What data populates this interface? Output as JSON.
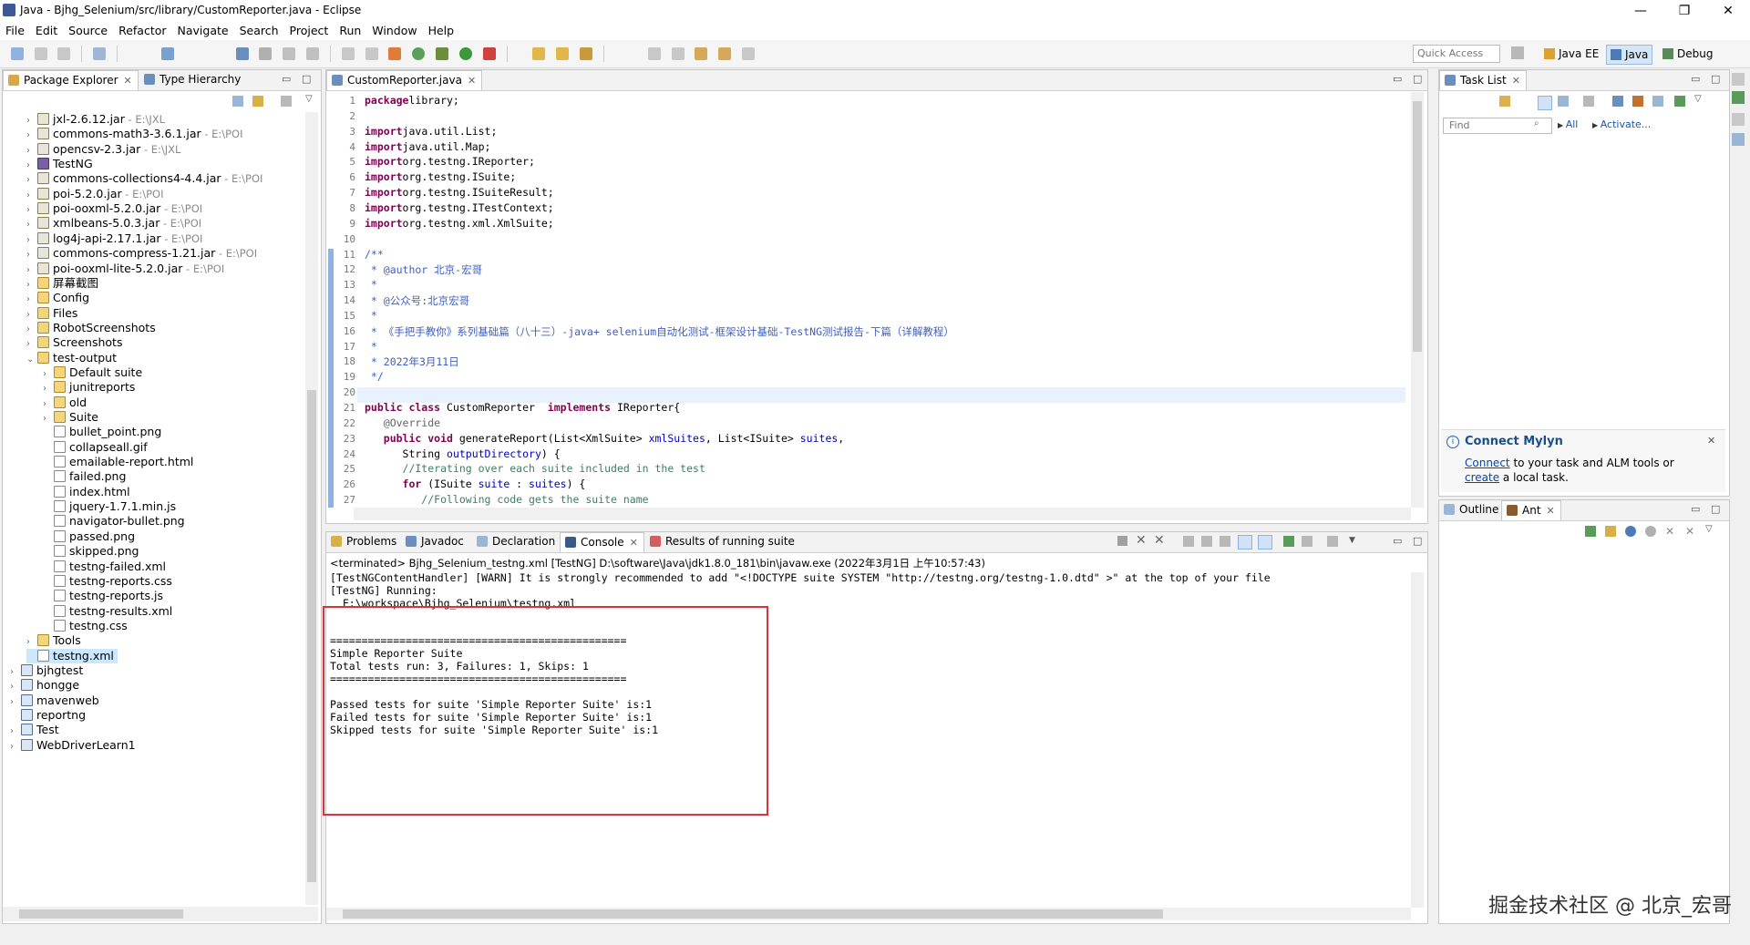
{
  "window": {
    "title": "Java - Bjhg_Selenium/src/library/CustomReporter.java - Eclipse",
    "controls": [
      "—",
      "❐",
      "✕"
    ]
  },
  "menu": [
    "File",
    "Edit",
    "Source",
    "Refactor",
    "Navigate",
    "Search",
    "Project",
    "Run",
    "Window",
    "Help"
  ],
  "toolbar": {
    "quick_access_placeholder": "Quick Access",
    "perspectives": [
      "Java EE",
      "Java",
      "Debug"
    ]
  },
  "package_explorer": {
    "tab1": "Package Explorer",
    "tab2": "Type Hierarchy",
    "items": [
      {
        "label": "jxl-2.6.12.jar",
        "loc": " - E:\\JXL",
        "type": "jar",
        "depth": 1,
        "arrow": "›"
      },
      {
        "label": "commons-math3-3.6.1.jar",
        "loc": " - E:\\POI",
        "type": "jar",
        "depth": 1,
        "arrow": "›"
      },
      {
        "label": "opencsv-2.3.jar",
        "loc": " - E:\\JXL",
        "type": "jar",
        "depth": 1,
        "arrow": "›"
      },
      {
        "label": "TestNG",
        "loc": "",
        "type": "lib",
        "depth": 1,
        "arrow": "›"
      },
      {
        "label": "commons-collections4-4.4.jar",
        "loc": " - E:\\POI",
        "type": "jar",
        "depth": 1,
        "arrow": "›"
      },
      {
        "label": "poi-5.2.0.jar",
        "loc": " - E:\\POI",
        "type": "jar",
        "depth": 1,
        "arrow": "›"
      },
      {
        "label": "poi-ooxml-5.2.0.jar",
        "loc": " - E:\\POI",
        "type": "jar",
        "depth": 1,
        "arrow": "›"
      },
      {
        "label": "xmlbeans-5.0.3.jar",
        "loc": " - E:\\POI",
        "type": "jar",
        "depth": 1,
        "arrow": "›"
      },
      {
        "label": "log4j-api-2.17.1.jar",
        "loc": " - E:\\POI",
        "type": "jar",
        "depth": 1,
        "arrow": "›"
      },
      {
        "label": "commons-compress-1.21.jar",
        "loc": " - E:\\POI",
        "type": "jar",
        "depth": 1,
        "arrow": "›"
      },
      {
        "label": "poi-ooxml-lite-5.2.0.jar",
        "loc": " - E:\\POI",
        "type": "jar",
        "depth": 1,
        "arrow": "›"
      },
      {
        "label": "屏幕截图",
        "loc": "",
        "type": "folder",
        "depth": 1,
        "arrow": "›"
      },
      {
        "label": "Config",
        "loc": "",
        "type": "folder",
        "depth": 1,
        "arrow": "›"
      },
      {
        "label": "Files",
        "loc": "",
        "type": "folder",
        "depth": 1,
        "arrow": "›"
      },
      {
        "label": "RobotScreenshots",
        "loc": "",
        "type": "folder",
        "depth": 1,
        "arrow": "›"
      },
      {
        "label": "Screenshots",
        "loc": "",
        "type": "folder",
        "depth": 1,
        "arrow": "›"
      },
      {
        "label": "test-output",
        "loc": "",
        "type": "folder",
        "depth": 1,
        "arrow": "⌄"
      },
      {
        "label": "Default suite",
        "loc": "",
        "type": "folder",
        "depth": 2,
        "arrow": "›"
      },
      {
        "label": "junitreports",
        "loc": "",
        "type": "folder",
        "depth": 2,
        "arrow": "›"
      },
      {
        "label": "old",
        "loc": "",
        "type": "folder",
        "depth": 2,
        "arrow": "›"
      },
      {
        "label": "Suite",
        "loc": "",
        "type": "folder",
        "depth": 2,
        "arrow": "›"
      },
      {
        "label": "bullet_point.png",
        "loc": "",
        "type": "file",
        "depth": 2,
        "arrow": ""
      },
      {
        "label": "collapseall.gif",
        "loc": "",
        "type": "file",
        "depth": 2,
        "arrow": ""
      },
      {
        "label": "emailable-report.html",
        "loc": "",
        "type": "file",
        "depth": 2,
        "arrow": ""
      },
      {
        "label": "failed.png",
        "loc": "",
        "type": "file",
        "depth": 2,
        "arrow": ""
      },
      {
        "label": "index.html",
        "loc": "",
        "type": "file",
        "depth": 2,
        "arrow": ""
      },
      {
        "label": "jquery-1.7.1.min.js",
        "loc": "",
        "type": "file",
        "depth": 2,
        "arrow": ""
      },
      {
        "label": "navigator-bullet.png",
        "loc": "",
        "type": "file",
        "depth": 2,
        "arrow": ""
      },
      {
        "label": "passed.png",
        "loc": "",
        "type": "file",
        "depth": 2,
        "arrow": ""
      },
      {
        "label": "skipped.png",
        "loc": "",
        "type": "file",
        "depth": 2,
        "arrow": ""
      },
      {
        "label": "testng-failed.xml",
        "loc": "",
        "type": "file",
        "depth": 2,
        "arrow": ""
      },
      {
        "label": "testng-reports.css",
        "loc": "",
        "type": "file",
        "depth": 2,
        "arrow": ""
      },
      {
        "label": "testng-reports.js",
        "loc": "",
        "type": "file",
        "depth": 2,
        "arrow": ""
      },
      {
        "label": "testng-results.xml",
        "loc": "",
        "type": "file",
        "depth": 2,
        "arrow": ""
      },
      {
        "label": "testng.css",
        "loc": "",
        "type": "file",
        "depth": 2,
        "arrow": ""
      },
      {
        "label": "Tools",
        "loc": "",
        "type": "folder",
        "depth": 1,
        "arrow": "›"
      },
      {
        "label": "testng.xml",
        "loc": "",
        "type": "file",
        "depth": 1,
        "arrow": "",
        "selected": true
      },
      {
        "label": "bjhgtest",
        "loc": "",
        "type": "proj",
        "depth": 0,
        "arrow": "›"
      },
      {
        "label": "hongge",
        "loc": "",
        "type": "proj",
        "depth": 0,
        "arrow": "›"
      },
      {
        "label": "mavenweb",
        "loc": "",
        "type": "proj",
        "depth": 0,
        "arrow": "›"
      },
      {
        "label": "reportng",
        "loc": "",
        "type": "proj",
        "depth": 0,
        "arrow": ""
      },
      {
        "label": "Test",
        "loc": "",
        "type": "proj",
        "depth": 0,
        "arrow": "›"
      },
      {
        "label": "WebDriverLearn1",
        "loc": "",
        "type": "proj",
        "depth": 0,
        "arrow": "›"
      }
    ]
  },
  "editor": {
    "tab": "CustomReporter.java",
    "lines": [
      [
        [
          "kw",
          "package"
        ],
        [
          "",
          "library;"
        ]
      ],
      [],
      [
        [
          "kw",
          "import"
        ],
        [
          "",
          "java.util.List;"
        ]
      ],
      [
        [
          "kw",
          "import"
        ],
        [
          "",
          "java.util.Map;"
        ]
      ],
      [
        [
          "kw",
          "import"
        ],
        [
          "",
          "org.testng.IReporter;"
        ]
      ],
      [
        [
          "kw",
          "import"
        ],
        [
          "",
          "org.testng.ISuite;"
        ]
      ],
      [
        [
          "kw",
          "import"
        ],
        [
          "",
          "org.testng.ISuiteResult;"
        ]
      ],
      [
        [
          "kw",
          "import"
        ],
        [
          "",
          "org.testng.ITestContext;"
        ]
      ],
      [
        [
          "kw",
          "import"
        ],
        [
          "",
          "org.testng.xml.XmlSuite;"
        ]
      ],
      [],
      [
        [
          "jd",
          "/**"
        ]
      ],
      [
        [
          "jd",
          " * @author 北京-宏哥"
        ]
      ],
      [
        [
          "jd",
          " *"
        ]
      ],
      [
        [
          "jd",
          " * @公众号:北京宏哥"
        ]
      ],
      [
        [
          "jd",
          " *"
        ]
      ],
      [
        [
          "jd",
          " * 《手把手教你》系列基础篇（八十三）-java+ selenium自动化测试-框架设计基础-TestNG测试报告-下篇（详解教程）"
        ]
      ],
      [
        [
          "jd",
          " *"
        ]
      ],
      [
        [
          "jd",
          " * 2022年3月11日"
        ]
      ],
      [
        [
          "jd",
          " */"
        ]
      ],
      [],
      [
        [
          "kw",
          "public class"
        ],
        [
          "",
          " CustomReporter "
        ],
        [
          "kw",
          "implements"
        ],
        [
          "",
          " IReporter{"
        ]
      ],
      [
        [
          "an",
          "   @Override"
        ]
      ],
      [
        [
          "kw",
          "   public void"
        ],
        [
          "",
          " generateReport(List<XmlSuite> "
        ],
        [
          "var",
          "xmlSuites"
        ],
        [
          "",
          ", List<ISuite> "
        ],
        [
          "var",
          "suites"
        ],
        [
          "",
          ","
        ]
      ],
      [
        [
          "",
          "      String "
        ],
        [
          "var",
          "outputDirectory"
        ],
        [
          "",
          ") {"
        ]
      ],
      [
        [
          "cm",
          "      //Iterating over each suite included in the test"
        ]
      ],
      [
        [
          "kw",
          "      for"
        ],
        [
          "",
          " (ISuite "
        ],
        [
          "var",
          "suite"
        ],
        [
          "",
          " : "
        ],
        [
          "var",
          "suites"
        ],
        [
          "",
          ") {"
        ]
      ],
      [
        [
          "cm",
          "         //Following code gets the suite name"
        ]
      ]
    ]
  },
  "task_list": {
    "tab": "Task List",
    "find_placeholder": "Find",
    "all_label": "All",
    "activate_label": "Activate...",
    "mylyn_title": "Connect Mylyn",
    "mylyn_connect": "Connect",
    "mylyn_text1": " to your task and ALM tools or ",
    "mylyn_create": "create",
    "mylyn_text2": " a local task."
  },
  "outline": {
    "tab1": "Outline",
    "tab2": "Ant"
  },
  "console": {
    "tabs": [
      "Problems",
      "Javadoc",
      "Declaration",
      "Console",
      "Results of running suite"
    ],
    "header": "<terminated> Bjhg_Selenium_testng.xml [TestNG] D:\\software\\Java\\jdk1.8.0_181\\bin\\javaw.exe (2022年3月1日 上午10:57:43)",
    "lines": [
      "[TestNGContentHandler] [WARN] It is strongly recommended to add \"<!DOCTYPE suite SYSTEM \"http://testng.org/testng-1.0.dtd\" >\" at the top of your file",
      "[TestNG] Running:",
      "  F:\\workspace\\Bjhg_Selenium\\testng.xml",
      "",
      "",
      "===============================================",
      "Simple Reporter Suite",
      "Total tests run: 3, Failures: 1, Skips: 1",
      "===============================================",
      "",
      "Passed tests for suite 'Simple Reporter Suite' is:1",
      "Failed tests for suite 'Simple Reporter Suite' is:1",
      "Skipped tests for suite 'Simple Reporter Suite' is:1"
    ]
  },
  "watermark": "掘金技术社区 @ 北京_宏哥",
  "colors": {
    "highlight_box": "#d9343d",
    "selection": "#cce8ff",
    "accent": "#0645ad"
  }
}
